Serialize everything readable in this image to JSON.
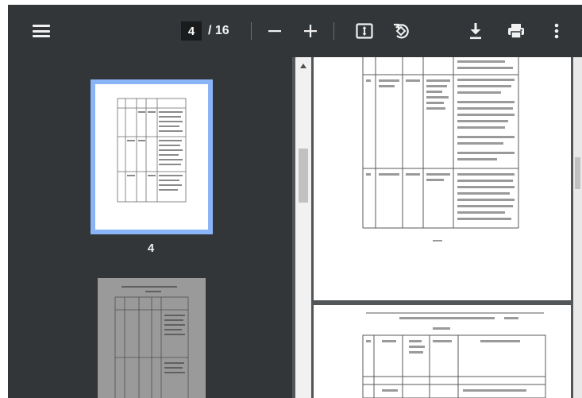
{
  "toolbar": {
    "current_page": "4",
    "page_total": "/ 16",
    "icons": [
      "menu-icon",
      "zoom-out-icon",
      "zoom-in-icon",
      "fit-page-icon",
      "rotate-icon",
      "download-icon",
      "print-icon",
      "more-vert-icon"
    ]
  },
  "sidebar": {
    "thumbnails": [
      {
        "label": "4",
        "selected": true
      },
      {
        "label": "",
        "selected": false
      }
    ]
  },
  "colors": {
    "toolbar_bg": "#323639",
    "viewer_bg": "#525659",
    "selection": "#8ab4f8"
  }
}
